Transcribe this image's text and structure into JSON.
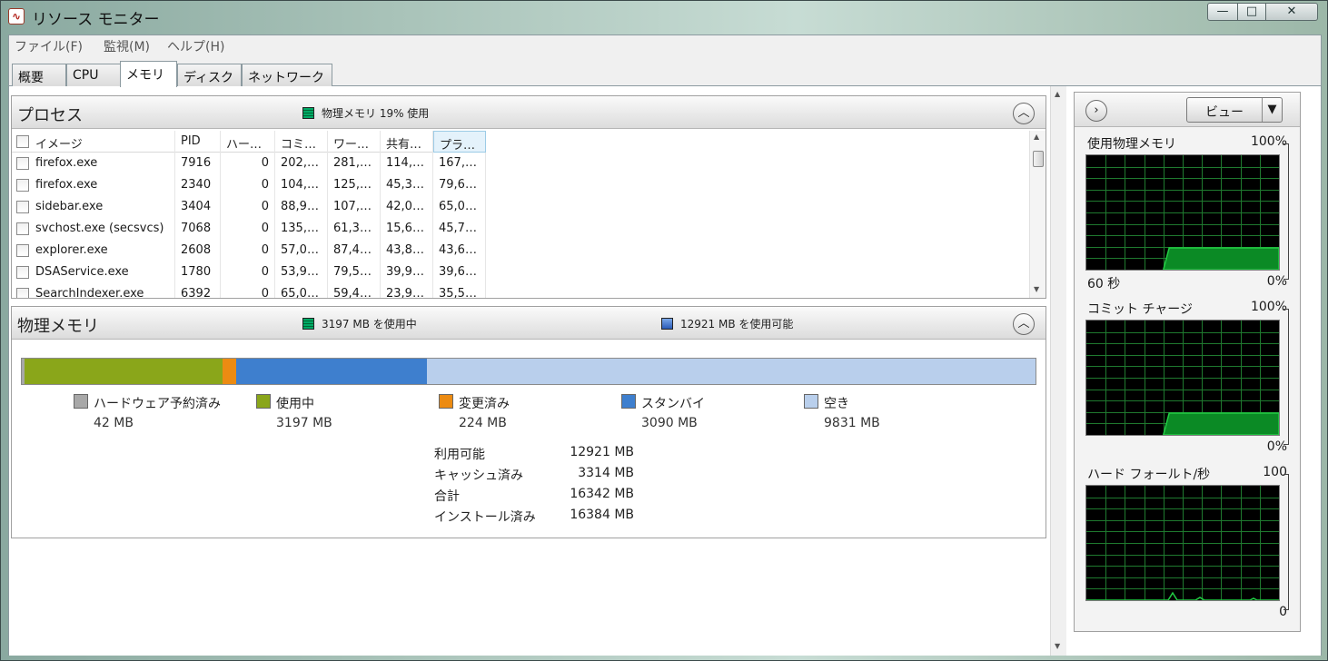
{
  "window": {
    "title": "リソース モニター",
    "app_icon": "resource-monitor-icon"
  },
  "window_controls": {
    "minimize": "—",
    "maximize": "□",
    "close": "✕"
  },
  "menu": [
    "ファイル(F)",
    "監視(M)",
    "ヘルプ(H)"
  ],
  "tabs": [
    {
      "label": "概要",
      "active": false
    },
    {
      "label": "CPU",
      "active": false
    },
    {
      "label": "メモリ",
      "active": true
    },
    {
      "label": "ディスク",
      "active": false
    },
    {
      "label": "ネットワーク",
      "active": false
    }
  ],
  "processes": {
    "title": "プロセス",
    "status": "物理メモリ 19% 使用",
    "columns": [
      "イメージ",
      "PID",
      "ハー…",
      "コミ…",
      "ワー…",
      "共有…",
      "プラ…"
    ],
    "rows": [
      [
        "firefox.exe",
        "7916",
        "0",
        "202,…",
        "281,…",
        "114,…",
        "167,…"
      ],
      [
        "firefox.exe",
        "2340",
        "0",
        "104,…",
        "125,…",
        "45,3…",
        "79,6…"
      ],
      [
        "sidebar.exe",
        "3404",
        "0",
        "88,9…",
        "107,…",
        "42,0…",
        "65,0…"
      ],
      [
        "svchost.exe (secsvcs)",
        "7068",
        "0",
        "135,…",
        "61,3…",
        "15,6…",
        "45,7…"
      ],
      [
        "explorer.exe",
        "2608",
        "0",
        "57,0…",
        "87,4…",
        "43,8…",
        "43,6…"
      ],
      [
        "DSAService.exe",
        "1780",
        "0",
        "53,9…",
        "79,5…",
        "39,9…",
        "39,6…"
      ],
      [
        "SearchIndexer.exe",
        "6392",
        "0",
        "65,0…",
        "59,4…",
        "23,9…",
        "35,5…"
      ]
    ]
  },
  "physical_memory": {
    "title": "物理メモリ",
    "in_use_status": "3197 MB を使用中",
    "available_status": "12921 MB を使用可能",
    "bar_total_mb": 16384,
    "segments": [
      {
        "name": "ハードウェア予約済み",
        "value": "42 MB",
        "mb": 42,
        "color": "#a8a8a8"
      },
      {
        "name": "使用中",
        "value": "3197 MB",
        "mb": 3197,
        "color": "#8aa61a"
      },
      {
        "name": "変更済み",
        "value": "224 MB",
        "mb": 224,
        "color": "#ec8b12"
      },
      {
        "name": "スタンバイ",
        "value": "3090 MB",
        "mb": 3090,
        "color": "#3e7fce"
      },
      {
        "name": "空き",
        "value": "9831 MB",
        "mb": 9831,
        "color": "#b9cfec"
      }
    ],
    "stats": [
      {
        "label": "利用可能",
        "value": "12921 MB"
      },
      {
        "label": "キャッシュ済み",
        "value": "3314 MB"
      },
      {
        "label": "合計",
        "value": "16342 MB"
      },
      {
        "label": "インストール済み",
        "value": "16384 MB"
      }
    ]
  },
  "graphs_panel": {
    "view_label": "ビュー",
    "graphs": [
      {
        "title": "使用物理メモリ",
        "max": "100%",
        "left_label": "60 秒",
        "min": "0%",
        "level": 0.19,
        "shape": "step"
      },
      {
        "title": "コミット チャージ",
        "max": "100%",
        "left_label": "",
        "min": "0%",
        "level": 0.19,
        "shape": "step"
      },
      {
        "title": "ハード フォールト/秒",
        "max": "100",
        "left_label": "",
        "min": "0",
        "level": 0.0,
        "shape": "spikes"
      }
    ]
  },
  "colors": {
    "graph_bg": "#000000",
    "graph_grid": "#1f7a2f",
    "graph_line": "#22cc44",
    "graph_fill": "#0b8a25"
  }
}
